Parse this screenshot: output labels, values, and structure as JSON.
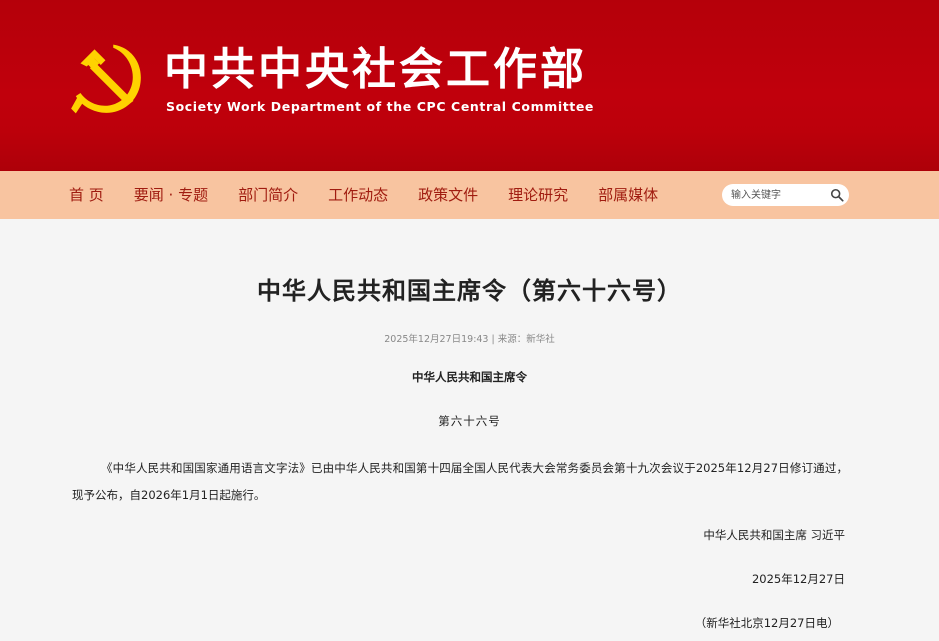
{
  "header": {
    "title": "中共中央社会工作部",
    "subtitle": "Society Work Department of the CPC Central Committee",
    "brand_red": "#c0000c",
    "emblem_color": "#ffd200"
  },
  "nav": {
    "bar_color": "#f8c4a0",
    "text_color": "#a01c10",
    "items": [
      {
        "label": "首 页"
      },
      {
        "label": "要闻 · 专题"
      },
      {
        "label": "部门简介"
      },
      {
        "label": "工作动态"
      },
      {
        "label": "政策文件"
      },
      {
        "label": "理论研究"
      },
      {
        "label": "部属媒体"
      }
    ]
  },
  "search": {
    "placeholder": "输入关键字",
    "icon": "search-icon"
  },
  "article": {
    "title": "中华人民共和国主席令（第六十六号）",
    "meta": "2025年12月27日19:43 | 来源：新华社",
    "issuer": "中华人民共和国主席令",
    "order_number": "第六十六号",
    "body": "《中华人民共和国国家通用语言文字法》已由中华人民共和国第十四届全国人民代表大会常务委员会第十九次会议于2025年12月27日修订通过，现予公布，自2026年1月1日起施行。",
    "signature": "中华人民共和国主席 习近平",
    "date": "2025年12月27日",
    "source_note": "（新华社北京12月27日电）"
  }
}
